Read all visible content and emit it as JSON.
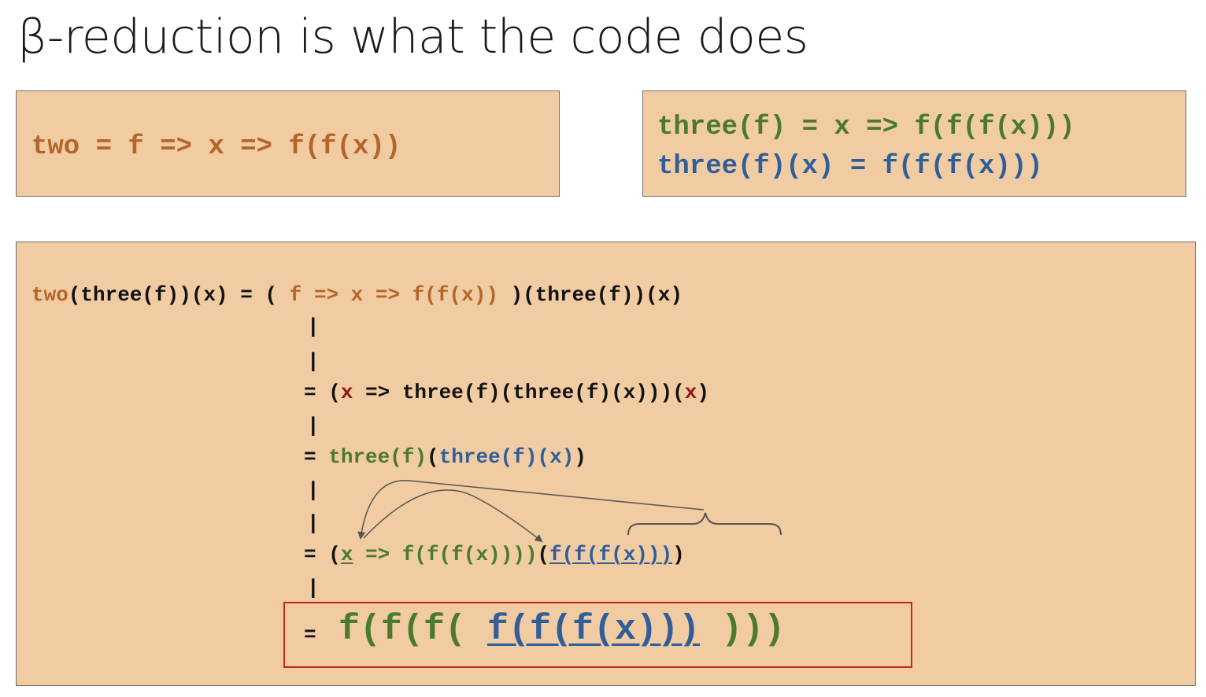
{
  "title": "β-reduction is what the code does",
  "box_two": {
    "name": "two",
    "def": " = f => x => f(f(x))"
  },
  "box_three": {
    "line1": "three(f) = x => f(f(f(x)))",
    "line2": "three(f)(x) = f(f(f(x)))"
  },
  "derivation": {
    "step0": {
      "lhs_two": "two",
      "lhs_rest": "(three(f))(x)",
      "eq": " = ( ",
      "lambda": "f => x => f(f(x))",
      "tail": " )(three(f))(x)"
    },
    "step1": {
      "eq": "= (",
      "param": "x",
      "body": " => three(f)(three(f)(x)))(",
      "arg": "x",
      "close": ")"
    },
    "step2": {
      "eq": "= ",
      "outer": "three(f)",
      "open": "(",
      "inner": "three(f)(x)",
      "close": ")"
    },
    "step3": {
      "eq": "= (",
      "param": "x",
      "body": " => f(f(f(x))))",
      "open": "(",
      "arg": "f(f(f(x)))",
      "close": ")"
    },
    "result": {
      "eq": "=",
      "outer_open": "f(f(f( ",
      "inner": "f(f(f(x)))",
      "outer_close": " )))"
    },
    "pipe": "|"
  },
  "colors": {
    "box_fill": "#f1cba2",
    "orange": "#b3662a",
    "green": "#4a7a2e",
    "blue": "#2f5e99",
    "dark_red": "#8a1a12",
    "highlight_border": "#c4281c"
  }
}
